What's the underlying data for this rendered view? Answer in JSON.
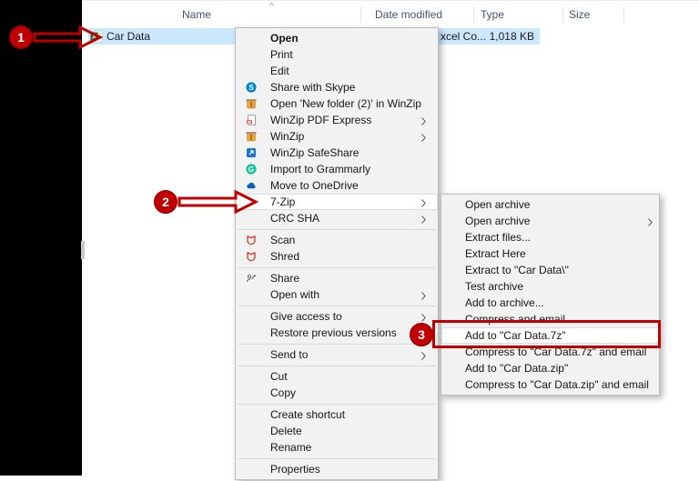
{
  "colors": {
    "annotation_red": "#c00000",
    "row_highlight_blue": "#cce8ff",
    "menu_background": "#f2f2f2",
    "excel_green": "#1e7145"
  },
  "annotations": {
    "step1": "1",
    "step2": "2",
    "step3": "3"
  },
  "explorer": {
    "columns": {
      "name": "Name",
      "date_modified": "Date modified",
      "type": "Type",
      "size": "Size",
      "sort_caret": "^"
    },
    "file": {
      "name": "Car Data",
      "icon": "excel-file-icon",
      "type_fragment": "xcel Co...",
      "size": "1,018 KB"
    }
  },
  "context_menu": {
    "items": [
      {
        "name": "open",
        "label": "Open",
        "bold": true
      },
      {
        "name": "print",
        "label": "Print"
      },
      {
        "name": "edit",
        "label": "Edit"
      },
      {
        "name": "share-with-skype",
        "label": "Share with Skype",
        "icon": "skype"
      },
      {
        "name": "open-new-folder-in-winzip",
        "label": "Open 'New folder (2)' in WinZip",
        "icon": "winzip"
      },
      {
        "name": "winzip-pdf-express",
        "label": "WinZip PDF Express",
        "icon": "winzip-pdf",
        "chevron": true
      },
      {
        "name": "winzip",
        "label": "WinZip",
        "icon": "winzip",
        "chevron": true
      },
      {
        "name": "winzip-safeshare",
        "label": "WinZip SafeShare",
        "icon": "safeshare"
      },
      {
        "name": "import-to-grammarly",
        "label": "Import to Grammarly",
        "icon": "grammarly"
      },
      {
        "name": "move-to-onedrive",
        "label": "Move to OneDrive",
        "icon": "onedrive"
      },
      {
        "name": "7-zip",
        "label": "7-Zip",
        "chevron": true,
        "highlighted": true
      },
      {
        "name": "crc-sha",
        "label": "CRC SHA",
        "chevron": true
      },
      {
        "separator": true
      },
      {
        "name": "scan",
        "label": "Scan",
        "icon": "shield"
      },
      {
        "name": "shred",
        "label": "Shred",
        "icon": "shield"
      },
      {
        "separator": true
      },
      {
        "name": "share",
        "label": "Share",
        "icon": "share"
      },
      {
        "name": "open-with",
        "label": "Open with",
        "chevron": true
      },
      {
        "separator": true
      },
      {
        "name": "give-access-to",
        "label": "Give access to",
        "chevron": true
      },
      {
        "name": "restore-previous-versions",
        "label": "Restore previous versions"
      },
      {
        "separator": true
      },
      {
        "name": "send-to",
        "label": "Send to",
        "chevron": true
      },
      {
        "separator": true
      },
      {
        "name": "cut",
        "label": "Cut"
      },
      {
        "name": "copy",
        "label": "Copy"
      },
      {
        "separator": true
      },
      {
        "name": "create-shortcut",
        "label": "Create shortcut"
      },
      {
        "name": "delete",
        "label": "Delete"
      },
      {
        "name": "rename",
        "label": "Rename"
      },
      {
        "separator": true
      },
      {
        "name": "properties",
        "label": "Properties"
      }
    ]
  },
  "submenu_7zip": {
    "items": [
      {
        "name": "open-archive",
        "label": "Open archive"
      },
      {
        "name": "open-archive-with",
        "label": "Open archive",
        "chevron": true
      },
      {
        "name": "extract-files",
        "label": "Extract files..."
      },
      {
        "name": "extract-here",
        "label": "Extract Here"
      },
      {
        "name": "extract-to-folder",
        "label": "Extract to \"Car Data\\\""
      },
      {
        "name": "test-archive",
        "label": "Test archive"
      },
      {
        "name": "add-to-archive",
        "label": "Add to archive..."
      },
      {
        "name": "compress-and-email",
        "label": "Compress and email..."
      },
      {
        "name": "add-to-7z",
        "label": "Add to \"Car Data.7z\"",
        "highlighted": true
      },
      {
        "name": "compress-to-7z-and-email",
        "label": "Compress to \"Car Data.7z\" and email"
      },
      {
        "name": "add-to-zip",
        "label": "Add to \"Car Data.zip\""
      },
      {
        "name": "compress-to-zip-and-email",
        "label": "Compress to \"Car Data.zip\" and email"
      }
    ]
  }
}
